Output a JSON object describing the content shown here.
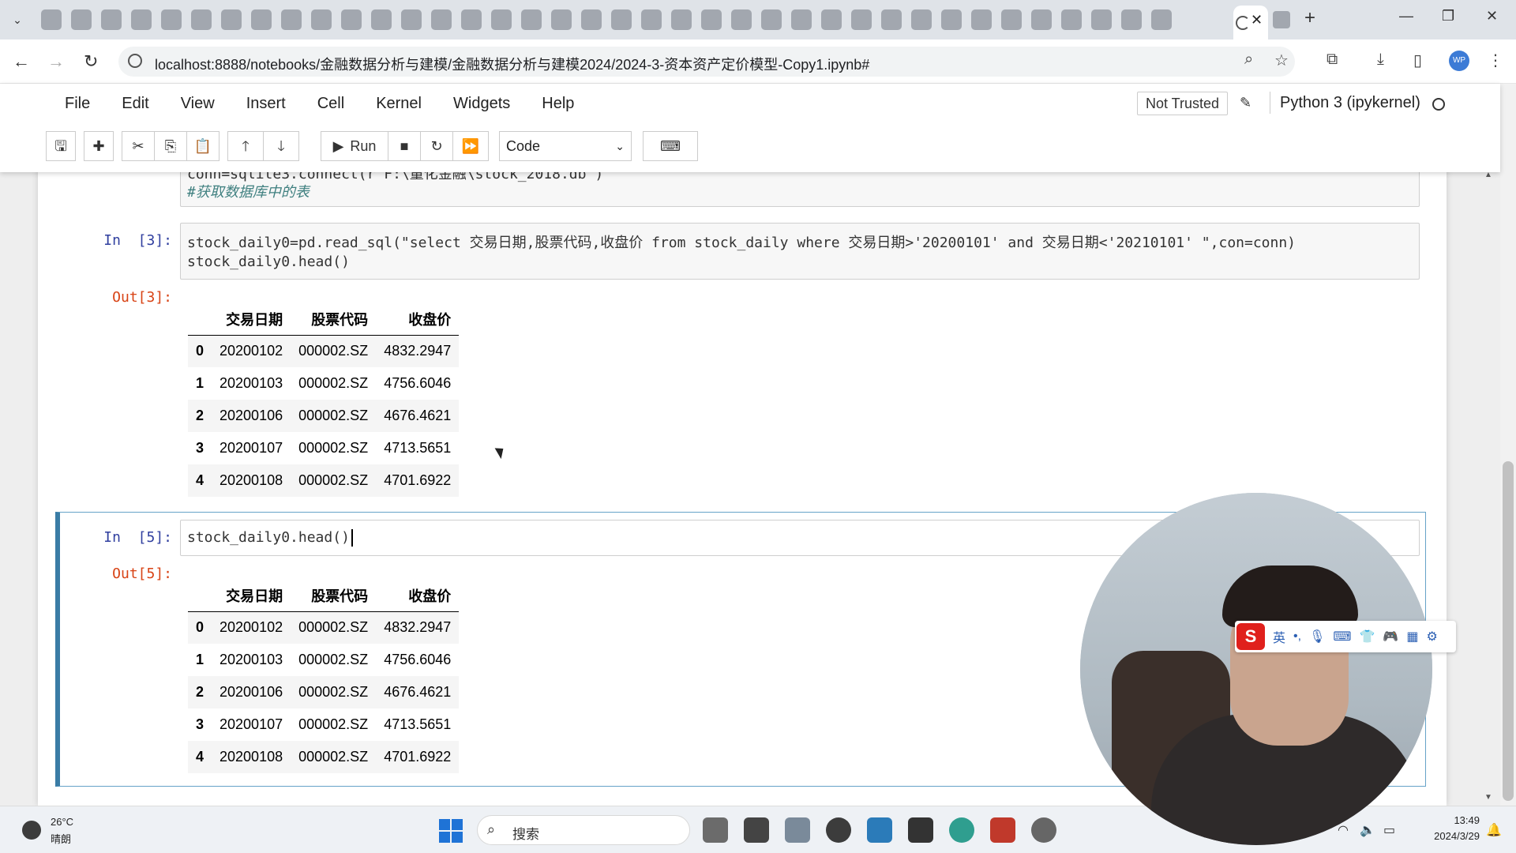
{
  "browser": {
    "url": "localhost:8888/notebooks/金融数据分析与建模/金融数据分析与建模2024/2024-3-资本资产定价模型-Copy1.ipynb#",
    "close_tab": "✕",
    "new_tab": "+",
    "profile_initials": "WP"
  },
  "jupyter": {
    "menu": [
      "File",
      "Edit",
      "View",
      "Insert",
      "Cell",
      "Kernel",
      "Widgets",
      "Help"
    ],
    "trust_status": "Not Trusted",
    "kernel": "Python 3 (ipykernel)",
    "run_label": "Run",
    "cell_type": "Code"
  },
  "cells": {
    "cell1": {
      "line1": "conn=sqlite3.connect(r'F:\\量化金融\\stock_2018.db')",
      "line2": "#获取数据库中的表"
    },
    "cell3": {
      "prompt": "In  [3]:",
      "line1": "stock_daily0=pd.read_sql(\"select 交易日期,股票代码,收盘价 from stock_daily where 交易日期>'20200101' and 交易日期<'20210101' \",con=conn)",
      "line2": "stock_daily0.head()",
      "out_prompt": "Out[3]:"
    },
    "cell5": {
      "prompt": "In  [5]:",
      "line1": "stock_daily0.head()",
      "out_prompt": "Out[5]:"
    }
  },
  "dataframe": {
    "columns": [
      "交易日期",
      "股票代码",
      "收盘价"
    ],
    "rows": [
      [
        "0",
        "20200102",
        "000002.SZ",
        "4832.2947"
      ],
      [
        "1",
        "20200103",
        "000002.SZ",
        "4756.6046"
      ],
      [
        "2",
        "20200106",
        "000002.SZ",
        "4676.4621"
      ],
      [
        "3",
        "20200107",
        "000002.SZ",
        "4713.5651"
      ],
      [
        "4",
        "20200108",
        "000002.SZ",
        "4701.6922"
      ]
    ]
  },
  "ime": {
    "logo": "S",
    "lang": "英"
  },
  "taskbar": {
    "temperature": "26°C",
    "condition": "晴朗",
    "search_placeholder": "搜索",
    "time": "13:49",
    "date": "2024/3/29"
  }
}
